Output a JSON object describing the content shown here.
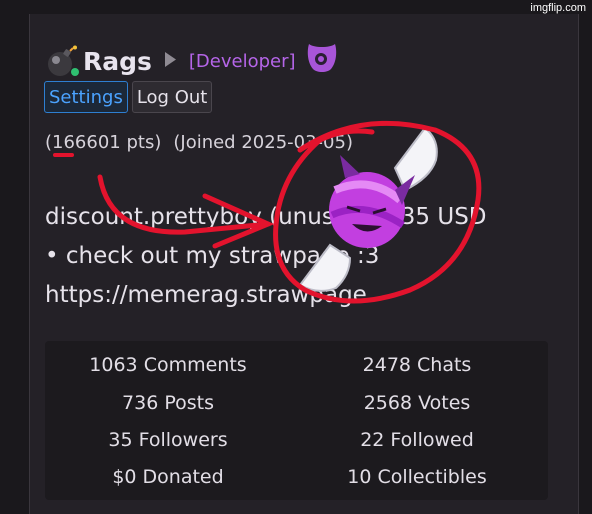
{
  "watermark": "imgflip.com",
  "profile": {
    "username": "Rags",
    "role": "[Developer]",
    "points": "166601",
    "joined": "2025-03-05"
  },
  "buttons": {
    "settings": "Settings",
    "logout": "Log Out"
  },
  "labels": {
    "pts_open": "(",
    "pts_suffix": " pts)",
    "joined_text": "(Joined 2025-03-05)"
  },
  "bio": {
    "line1": "discount.prettyboy (unused) 0.35 USD",
    "line2": " •  check out my strawpage :3",
    "line3": "https://memerag.strawpage"
  },
  "stats": {
    "comments": "1063 Comments",
    "chats": "2478 Chats",
    "posts": "736 Posts",
    "votes": "2568 Votes",
    "followers": "35 Followers",
    "followed": "22 Followed",
    "donated": "$0 Donated",
    "collectibles": "10 Collectibles"
  },
  "icons": {
    "avatar": "bomb-icon",
    "caret": "play-caret-icon",
    "role_badge": "shield-badge-icon",
    "collectible": "candy-icon"
  },
  "colors": {
    "accent": "#b565e8",
    "link": "#4ba3ff",
    "annotation": "#e3132d"
  }
}
